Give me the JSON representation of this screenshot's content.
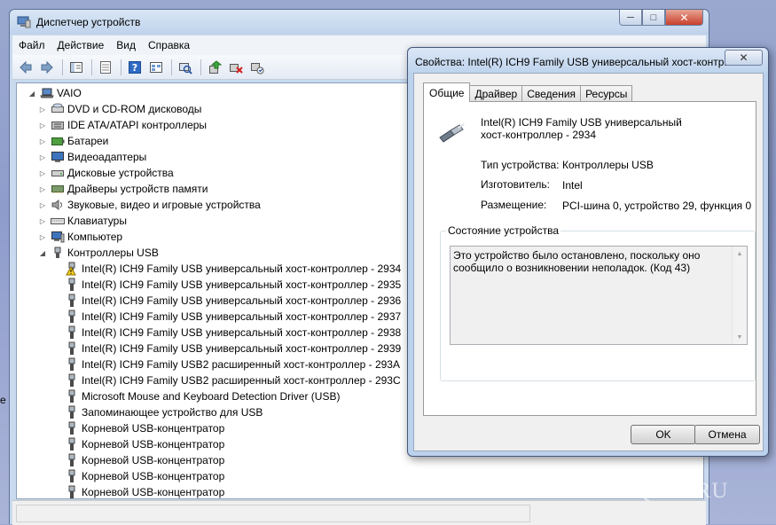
{
  "window": {
    "title": "Диспетчер устройств"
  },
  "menu": [
    "Файл",
    "Действие",
    "Вид",
    "Справка"
  ],
  "toolbar_icons": [
    "back-icon",
    "forward-icon",
    "show-hide-tree-icon",
    "properties-icon",
    "help-icon",
    "view-icon",
    "scan-hardware-icon",
    "update-driver-icon",
    "uninstall-icon",
    "disable-icon"
  ],
  "tree": {
    "root": "VAIO",
    "categories": [
      {
        "label": "DVD и CD-ROM дисководы",
        "icon": "dvd-drive-icon"
      },
      {
        "label": "IDE ATA/ATAPI контроллеры",
        "icon": "ide-controller-icon"
      },
      {
        "label": "Батареи",
        "icon": "battery-icon"
      },
      {
        "label": "Видеоадаптеры",
        "icon": "display-adapter-icon"
      },
      {
        "label": "Дисковые устройства",
        "icon": "disk-drive-icon"
      },
      {
        "label": "Драйверы устройств памяти",
        "icon": "memory-device-icon"
      },
      {
        "label": "Звуковые, видео и игровые устройства",
        "icon": "sound-device-icon"
      },
      {
        "label": "Клавиатуры",
        "icon": "keyboard-icon"
      },
      {
        "label": "Компьютер",
        "icon": "computer-icon"
      },
      {
        "label": "Контроллеры USB",
        "icon": "usb-icon"
      }
    ],
    "usb_children": [
      {
        "label": "Intel(R) ICH9 Family USB универсальный хост-контроллер  - 2934",
        "warning": true
      },
      {
        "label": "Intel(R) ICH9 Family USB универсальный хост-контроллер  - 2935",
        "warning": false
      },
      {
        "label": "Intel(R) ICH9 Family USB универсальный хост-контроллер  - 2936",
        "warning": false
      },
      {
        "label": "Intel(R) ICH9 Family USB универсальный хост-контроллер  - 2937",
        "warning": false
      },
      {
        "label": "Intel(R) ICH9 Family USB универсальный хост-контроллер  - 2938",
        "warning": false
      },
      {
        "label": "Intel(R) ICH9 Family USB универсальный хост-контроллер  - 2939",
        "warning": false
      },
      {
        "label": "Intel(R) ICH9 Family USB2 расширенный хост-контроллер  - 293A",
        "warning": false
      },
      {
        "label": "Intel(R) ICH9 Family USB2 расширенный хост-контроллер  - 293C",
        "warning": false
      },
      {
        "label": "Microsoft Mouse and Keyboard Detection Driver (USB)",
        "warning": false
      },
      {
        "label": "Запоминающее устройство для USB",
        "warning": false
      },
      {
        "label": "Корневой USB-концентратор",
        "warning": false
      },
      {
        "label": "Корневой USB-концентратор",
        "warning": false
      },
      {
        "label": "Корневой USB-концентратор",
        "warning": false
      },
      {
        "label": "Корневой USB-концентратор",
        "warning": false
      },
      {
        "label": "Корневой USB-концентратор",
        "warning": false
      }
    ]
  },
  "dialog": {
    "title": "Свойства: Intel(R) ICH9 Family USB универсальный хост-контр...",
    "tabs": [
      "Общие",
      "Драйвер",
      "Сведения",
      "Ресурсы"
    ],
    "device_name_line1": "Intel(R) ICH9 Family USB универсальный",
    "device_name_line2": "хост-контроллер  - 2934",
    "props": [
      {
        "label": "Тип устройства:",
        "value": "Контроллеры USB"
      },
      {
        "label": "Изготовитель:",
        "value": "Intel"
      },
      {
        "label": "Размещение:",
        "value": "PCI-шина 0, устройство 29, функция 0"
      }
    ],
    "status_group_label": "Состояние устройства",
    "status_text": "Это устройство было остановлено, поскольку оно сообщило о возникновении неполадок. (Код 43)",
    "ok": "OK",
    "cancel": "Отмена"
  },
  "watermark": "FAQLIB.RU",
  "edge_char": "e"
}
